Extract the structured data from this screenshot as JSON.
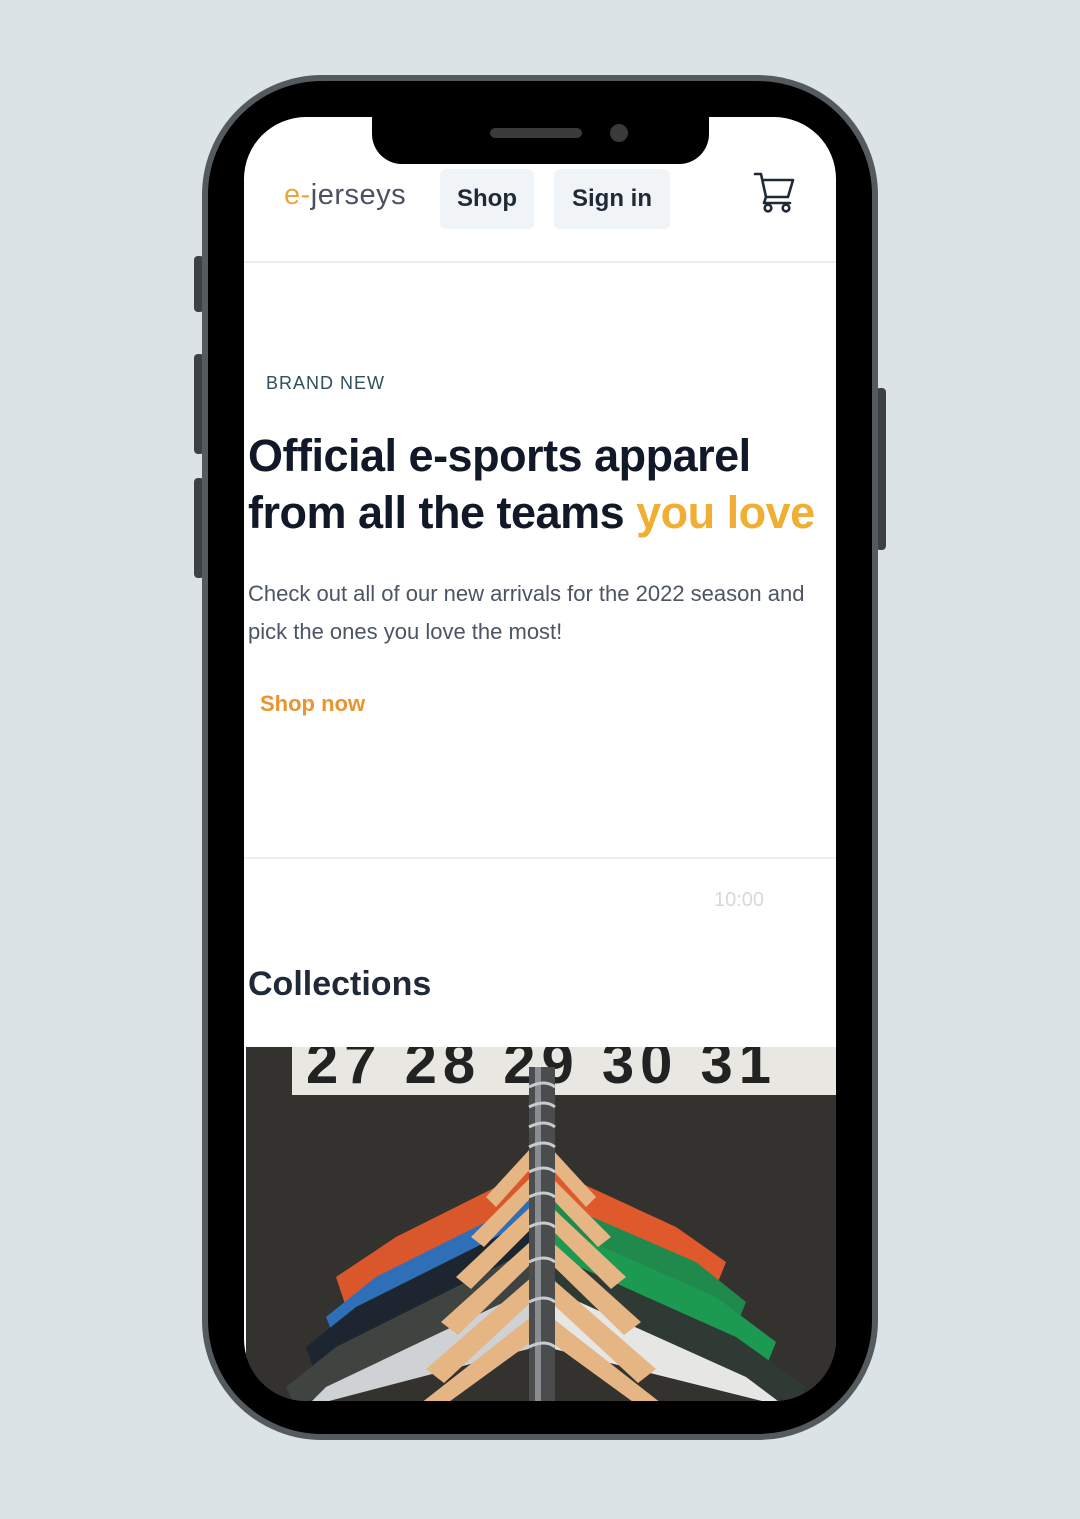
{
  "header": {
    "logo_prefix": "e-",
    "logo_name": "jerseys",
    "nav_shop_label": "Shop",
    "nav_signin_label": "Sign in",
    "cart_icon": "shopping-cart-icon"
  },
  "hero": {
    "eyebrow": "BRAND NEW",
    "title_main": "Official e-sports apparel from all the teams ",
    "title_accent": "you love",
    "description": "Check out all of our new arrivals for the 2022 season and pick the ones you love the most!",
    "cta_label": "Shop now"
  },
  "status": {
    "time": "10:00"
  },
  "collections": {
    "title": "Collections",
    "image_sign_text": "27 28 29 30 31"
  },
  "colors": {
    "accent": "#f0ae32",
    "cta": "#e8952f",
    "text_dark": "#111827",
    "background": "#dbe3e6"
  }
}
